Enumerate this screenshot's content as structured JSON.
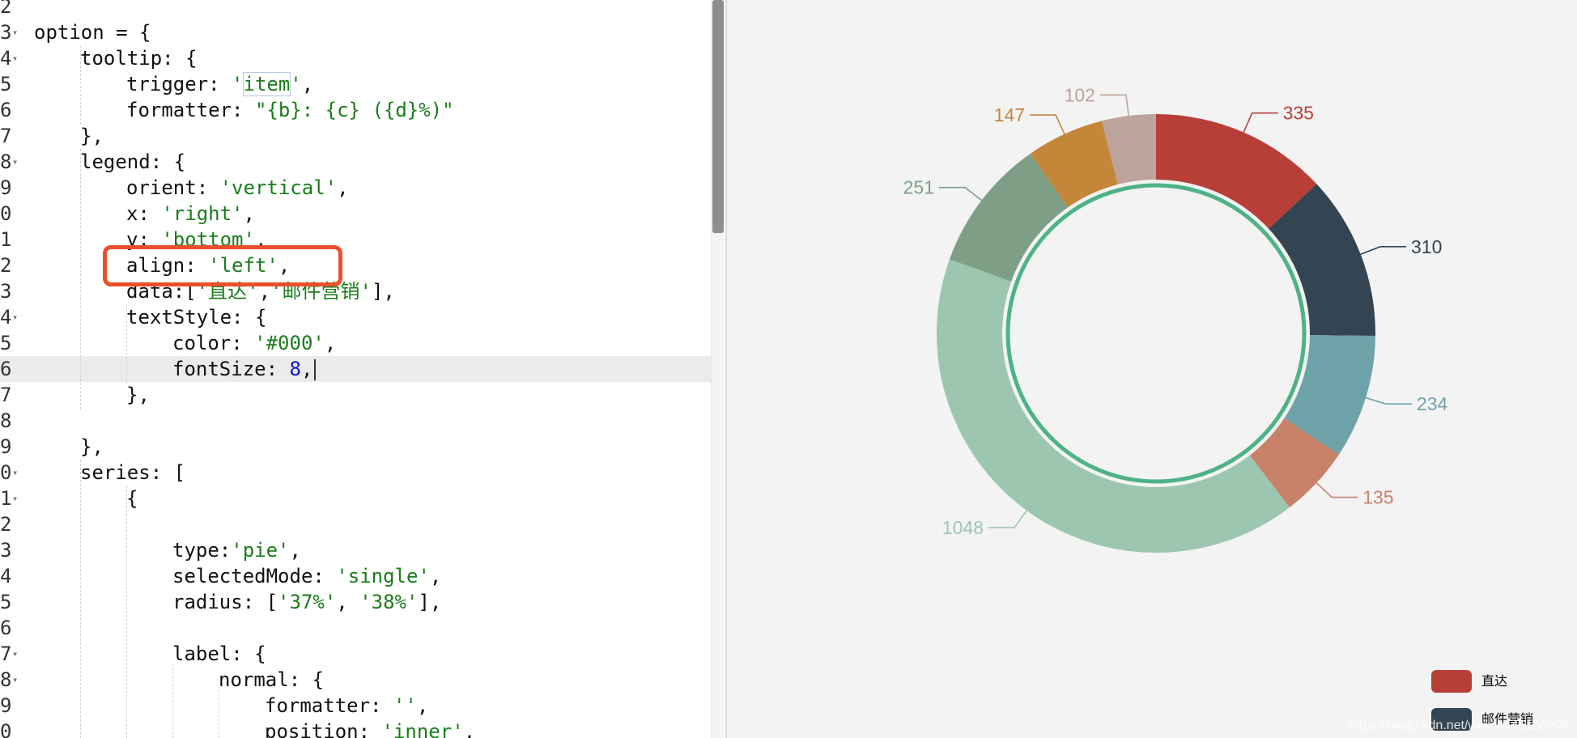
{
  "editor": {
    "lines": [
      {
        "no": "2",
        "fold": false,
        "indent": 0,
        "tokens": []
      },
      {
        "no": "3",
        "fold": true,
        "indent": 0,
        "tokens": [
          {
            "t": "option ",
            "c": "plain"
          },
          {
            "t": "=",
            "c": "plain"
          },
          {
            "t": " {",
            "c": "plain"
          }
        ]
      },
      {
        "no": "4",
        "fold": true,
        "indent": 1,
        "tokens": [
          {
            "t": "tooltip: {",
            "c": "plain"
          }
        ]
      },
      {
        "no": "5",
        "fold": false,
        "indent": 2,
        "tokens": [
          {
            "t": "trigger: ",
            "c": "plain"
          },
          {
            "t": "'",
            "c": "str"
          },
          {
            "t": "item",
            "c": "str-hl"
          },
          {
            "t": "'",
            "c": "str"
          },
          {
            "t": ",",
            "c": "plain"
          }
        ]
      },
      {
        "no": "6",
        "fold": false,
        "indent": 2,
        "tokens": [
          {
            "t": "formatter: ",
            "c": "plain"
          },
          {
            "t": "\"{b}: {c} ({d}%)\"",
            "c": "str"
          }
        ]
      },
      {
        "no": "7",
        "fold": false,
        "indent": 1,
        "tokens": [
          {
            "t": "},",
            "c": "plain"
          }
        ]
      },
      {
        "no": "8",
        "fold": true,
        "indent": 1,
        "tokens": [
          {
            "t": "legend: {",
            "c": "plain"
          }
        ]
      },
      {
        "no": "9",
        "fold": false,
        "indent": 2,
        "tokens": [
          {
            "t": "orient: ",
            "c": "plain"
          },
          {
            "t": "'vertical'",
            "c": "str"
          },
          {
            "t": ",",
            "c": "plain"
          }
        ]
      },
      {
        "no": "0",
        "fold": false,
        "indent": 2,
        "tokens": [
          {
            "t": "x: ",
            "c": "plain"
          },
          {
            "t": "'right'",
            "c": "str"
          },
          {
            "t": ",",
            "c": "plain"
          }
        ]
      },
      {
        "no": "1",
        "fold": false,
        "indent": 2,
        "tokens": [
          {
            "t": "y: ",
            "c": "plain"
          },
          {
            "t": "'bottom'",
            "c": "str"
          },
          {
            "t": ",",
            "c": "plain"
          }
        ]
      },
      {
        "no": "2",
        "fold": false,
        "indent": 2,
        "tokens": [
          {
            "t": "align: ",
            "c": "plain"
          },
          {
            "t": "'left'",
            "c": "str"
          },
          {
            "t": ",",
            "c": "plain"
          }
        ]
      },
      {
        "no": "3",
        "fold": false,
        "indent": 2,
        "tokens": [
          {
            "t": "data:[",
            "c": "plain"
          },
          {
            "t": "'直达'",
            "c": "str"
          },
          {
            "t": ",",
            "c": "plain"
          },
          {
            "t": "'邮件营销'",
            "c": "str"
          },
          {
            "t": "],",
            "c": "plain"
          }
        ]
      },
      {
        "no": "4",
        "fold": true,
        "indent": 2,
        "tokens": [
          {
            "t": "textStyle: {",
            "c": "plain"
          }
        ]
      },
      {
        "no": "5",
        "fold": false,
        "indent": 3,
        "tokens": [
          {
            "t": "color: ",
            "c": "plain"
          },
          {
            "t": "'#000'",
            "c": "str"
          },
          {
            "t": ",",
            "c": "plain"
          }
        ]
      },
      {
        "no": "6",
        "fold": false,
        "indent": 3,
        "active": true,
        "cursor": true,
        "tokens": [
          {
            "t": "fontSize: ",
            "c": "plain"
          },
          {
            "t": "8",
            "c": "num"
          },
          {
            "t": ",",
            "c": "plain"
          }
        ]
      },
      {
        "no": "7",
        "fold": false,
        "indent": 2,
        "tokens": [
          {
            "t": "},",
            "c": "plain"
          }
        ]
      },
      {
        "no": "8",
        "fold": false,
        "indent": 0,
        "tokens": []
      },
      {
        "no": "9",
        "fold": false,
        "indent": 1,
        "tokens": [
          {
            "t": "},",
            "c": "plain"
          }
        ]
      },
      {
        "no": "0",
        "fold": true,
        "indent": 1,
        "tokens": [
          {
            "t": "series: [",
            "c": "plain"
          }
        ]
      },
      {
        "no": "1",
        "fold": true,
        "indent": 2,
        "tokens": [
          {
            "t": "{",
            "c": "plain"
          }
        ]
      },
      {
        "no": "2",
        "fold": false,
        "indent": 0,
        "tokens": []
      },
      {
        "no": "3",
        "fold": false,
        "indent": 3,
        "tokens": [
          {
            "t": "type:",
            "c": "plain"
          },
          {
            "t": "'pie'",
            "c": "str"
          },
          {
            "t": ",",
            "c": "plain"
          }
        ]
      },
      {
        "no": "4",
        "fold": false,
        "indent": 3,
        "tokens": [
          {
            "t": "selectedMode: ",
            "c": "plain"
          },
          {
            "t": "'single'",
            "c": "str"
          },
          {
            "t": ",",
            "c": "plain"
          }
        ]
      },
      {
        "no": "5",
        "fold": false,
        "indent": 3,
        "tokens": [
          {
            "t": "radius: [",
            "c": "plain"
          },
          {
            "t": "'37%'",
            "c": "str"
          },
          {
            "t": ", ",
            "c": "plain"
          },
          {
            "t": "'38%'",
            "c": "str"
          },
          {
            "t": "],",
            "c": "plain"
          }
        ]
      },
      {
        "no": "6",
        "fold": false,
        "indent": 0,
        "tokens": []
      },
      {
        "no": "7",
        "fold": true,
        "indent": 3,
        "tokens": [
          {
            "t": "label: {",
            "c": "plain"
          }
        ]
      },
      {
        "no": "8",
        "fold": true,
        "indent": 4,
        "tokens": [
          {
            "t": "normal: {",
            "c": "plain"
          }
        ]
      },
      {
        "no": "9",
        "fold": false,
        "indent": 5,
        "tokens": [
          {
            "t": "formatter: ",
            "c": "plain"
          },
          {
            "t": "''",
            "c": "str"
          },
          {
            "t": ",",
            "c": "plain"
          }
        ]
      },
      {
        "no": "0",
        "fold": false,
        "indent": 5,
        "tokens": [
          {
            "t": "position: ",
            "c": "plain"
          },
          {
            "t": "'inner'",
            "c": "str"
          },
          {
            "t": ",",
            "c": "plain"
          }
        ]
      }
    ]
  },
  "chart_data": {
    "type": "pie",
    "start_angle_deg": 90,
    "slices": [
      {
        "value": 335,
        "label": "335",
        "color": "#b83f38"
      },
      {
        "value": 310,
        "label": "310",
        "color": "#334452"
      },
      {
        "value": 234,
        "label": "234",
        "color": "#6fa3aa"
      },
      {
        "value": 135,
        "label": "135",
        "color": "#c9826a"
      },
      {
        "value": 1048,
        "label": "1048",
        "color": "#9cc6b0"
      },
      {
        "value": 251,
        "label": "251",
        "color": "#7e9f86"
      },
      {
        "value": 147,
        "label": "147",
        "color": "#c4873a"
      },
      {
        "value": 102,
        "label": "102",
        "color": "#bca39b"
      }
    ],
    "inner_ring_color": "#4fb287",
    "legend": [
      {
        "name": "直达",
        "color": "#b83f38"
      },
      {
        "name": "邮件营销",
        "color": "#334452"
      }
    ],
    "legend_position": "bottom-right"
  },
  "watermark": "https://blog.csdn.net/weixin_45180306"
}
